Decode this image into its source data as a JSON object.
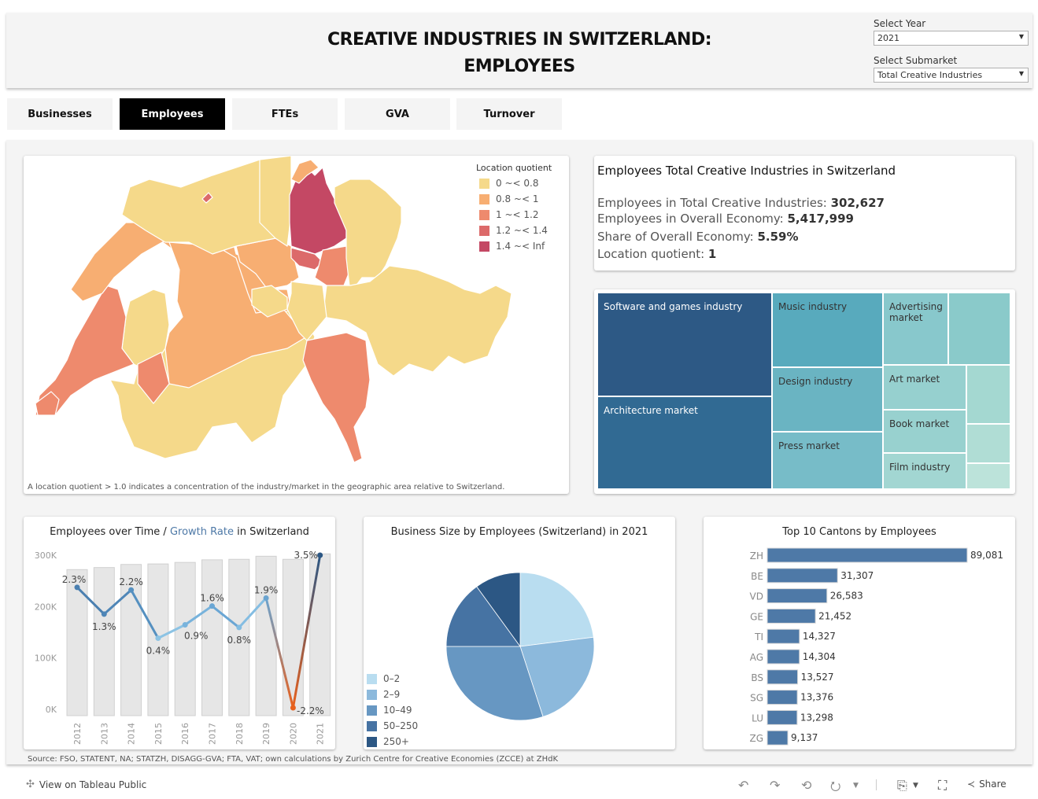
{
  "header": {
    "title_line1": "CREATIVE INDUSTRIES IN SWITZERLAND:",
    "title_line2": "EMPLOYEES",
    "year_filter": {
      "label": "Select Year",
      "value": "2021"
    },
    "submarket_filter": {
      "label": "Select Submarket",
      "value": "Total Creative Industries"
    }
  },
  "tabs": [
    {
      "label": "Businesses",
      "active": false
    },
    {
      "label": "Employees",
      "active": true
    },
    {
      "label": "FTEs",
      "active": false
    },
    {
      "label": "GVA",
      "active": false
    },
    {
      "label": "Turnover",
      "active": false
    }
  ],
  "map": {
    "legend_title": "Location quotient",
    "legend": [
      {
        "label": "0 ~< 0.8",
        "color": "#f5d98a"
      },
      {
        "label": "0.8 ~< 1",
        "color": "#f7ae72"
      },
      {
        "label": "1 ~< 1.2",
        "color": "#ee8a6d"
      },
      {
        "label": "1.2 ~< 1.4",
        "color": "#dc6a6a"
      },
      {
        "label": "1.4 ~< Inf",
        "color": "#c44864"
      }
    ],
    "note": "A location quotient > 1.0 indicates a concentration of the industry/market in the geographic area relative to Switzerland."
  },
  "kpi": {
    "title": "Employees Total Creative Industries in Switzerland",
    "lines": [
      {
        "label": "Employees in Total Creative Industries: ",
        "value": "302,627"
      },
      {
        "label": "Employees in Overall Economy: ",
        "value": "5,417,999"
      },
      {
        "label": "Share of Overall Economy:  ",
        "value": "5.59%"
      },
      {
        "label": "Location quotient: ",
        "value": "1"
      }
    ]
  },
  "treemap": {
    "items": [
      {
        "label": "Software and games industry",
        "color": "#2d5985"
      },
      {
        "label": "Architecture market",
        "color": "#316a93"
      },
      {
        "label": "Music industry",
        "color": "#58aabd"
      },
      {
        "label": "Design industry",
        "color": "#6ab4c2"
      },
      {
        "label": "Press market",
        "color": "#77bcc8"
      },
      {
        "label": "Advertising market",
        "color": "#88c8cc"
      },
      {
        "label": "",
        "color": "#8acaca"
      },
      {
        "label": "Art market",
        "color": "#96d0cf"
      },
      {
        "label": "Book market",
        "color": "#98d1cf"
      },
      {
        "label": "Film industry",
        "color": "#a2d6d2"
      },
      {
        "label": "",
        "color": "#a4d8d1"
      },
      {
        "label": "",
        "color": "#b0ddd5"
      },
      {
        "label": "",
        "color": "#bce3da"
      }
    ]
  },
  "chart_data": [
    {
      "type": "bar",
      "title": "Employees over Time / Growth Rate in Switzerland",
      "title_parts": [
        "Employees over Time / ",
        "Growth Rate",
        " in Switzerland"
      ],
      "categories": [
        "2012",
        "2013",
        "2014",
        "2015",
        "2016",
        "2017",
        "2018",
        "2019",
        "2020",
        "2021"
      ],
      "series": [
        {
          "name": "Employees",
          "values": [
            272000,
            276000,
            282000,
            283000,
            286000,
            291000,
            292000,
            298000,
            292000,
            302627
          ]
        },
        {
          "name": "Growth Rate",
          "type": "line",
          "values": [
            2.3,
            1.3,
            2.2,
            0.4,
            0.9,
            1.6,
            0.8,
            1.9,
            -2.2,
            3.5
          ],
          "labels": [
            "2.3%",
            "1.3%",
            "2.2%",
            "0.4%",
            "0.9%",
            "1.6%",
            "0.8%",
            "1.9%",
            "-2.2%",
            "3.5%"
          ]
        }
      ],
      "yticks": [
        "0K",
        "100K",
        "200K",
        "300K"
      ],
      "ylim": [
        0,
        300000
      ],
      "grid": false
    },
    {
      "type": "pie",
      "title": "Business Size by Employees (Switzerland) in 2021",
      "categories": [
        "0–2",
        "2–9",
        "10–49",
        "50–250",
        "250+"
      ],
      "values": [
        23,
        22,
        30,
        15,
        10
      ],
      "colors": [
        "#b9ddf0",
        "#8cb9dc",
        "#6797c2",
        "#4673a3",
        "#2c5784"
      ],
      "legend": "bottom-left"
    },
    {
      "type": "bar",
      "orientation": "horizontal",
      "title": "Top 10 Cantons by Employees",
      "categories": [
        "ZH",
        "BE",
        "VD",
        "GE",
        "TI",
        "AG",
        "BS",
        "SG",
        "LU",
        "ZG"
      ],
      "values": [
        89081,
        31307,
        26583,
        21452,
        14327,
        14304,
        13527,
        13376,
        13298,
        9137
      ],
      "labels": [
        "89,081",
        "31,307",
        "26,583",
        "21,452",
        "14,327",
        "14,304",
        "13,527",
        "13,376",
        "13,298",
        "9,137"
      ],
      "color": "#4e79a7"
    }
  ],
  "source": "Source: FSO, STATENT, NA; STATZH, DISAGG-GVA; FTA, VAT; own calculations by Zurich Centre for Creative Economies (ZCCE) at ZHdK",
  "footer": {
    "view_label": "View on Tableau Public",
    "share_label": "Share"
  }
}
